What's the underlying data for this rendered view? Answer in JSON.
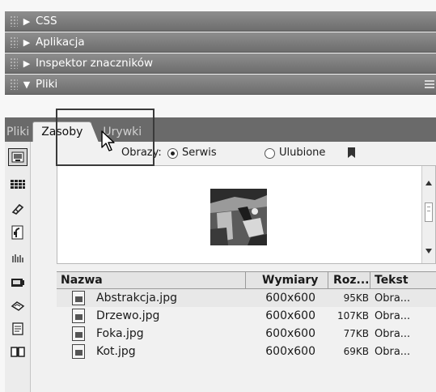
{
  "panels": [
    {
      "label": "CSS",
      "state": "collapsed"
    },
    {
      "label": "Aplikacja",
      "state": "collapsed"
    },
    {
      "label": "Inspektor znaczników",
      "state": "collapsed"
    },
    {
      "label": "Pliki",
      "state": "expanded"
    }
  ],
  "tabs": [
    {
      "label": "Pliki",
      "active": false
    },
    {
      "label": "Zasoby",
      "active": true
    },
    {
      "label": "Urywki",
      "active": false
    }
  ],
  "assets": {
    "filter_label": "Obrazy:",
    "options": [
      {
        "label": "Serwis",
        "checked": true
      },
      {
        "label": "Ulubione",
        "checked": false
      }
    ]
  },
  "sidebar_icons": [
    "images-icon",
    "colors-icon",
    "urls-icon",
    "flash-icon",
    "shockwave-icon",
    "movies-icon",
    "scripts-icon",
    "templates-icon",
    "library-icon"
  ],
  "table": {
    "columns": [
      "Nazwa",
      "Wymiary",
      "Roz...",
      "Tekst"
    ],
    "rows": [
      {
        "name": "Abstrakcja.jpg",
        "dims": "600x600",
        "size": "95KB",
        "type": "Obra..."
      },
      {
        "name": "Drzewo.jpg",
        "dims": "600x600",
        "size": "107KB",
        "type": "Obra..."
      },
      {
        "name": "Foka.jpg",
        "dims": "600x600",
        "size": "77KB",
        "type": "Obra..."
      },
      {
        "name": "Kot.jpg",
        "dims": "600x600",
        "size": "69KB",
        "type": "Obra..."
      }
    ]
  }
}
